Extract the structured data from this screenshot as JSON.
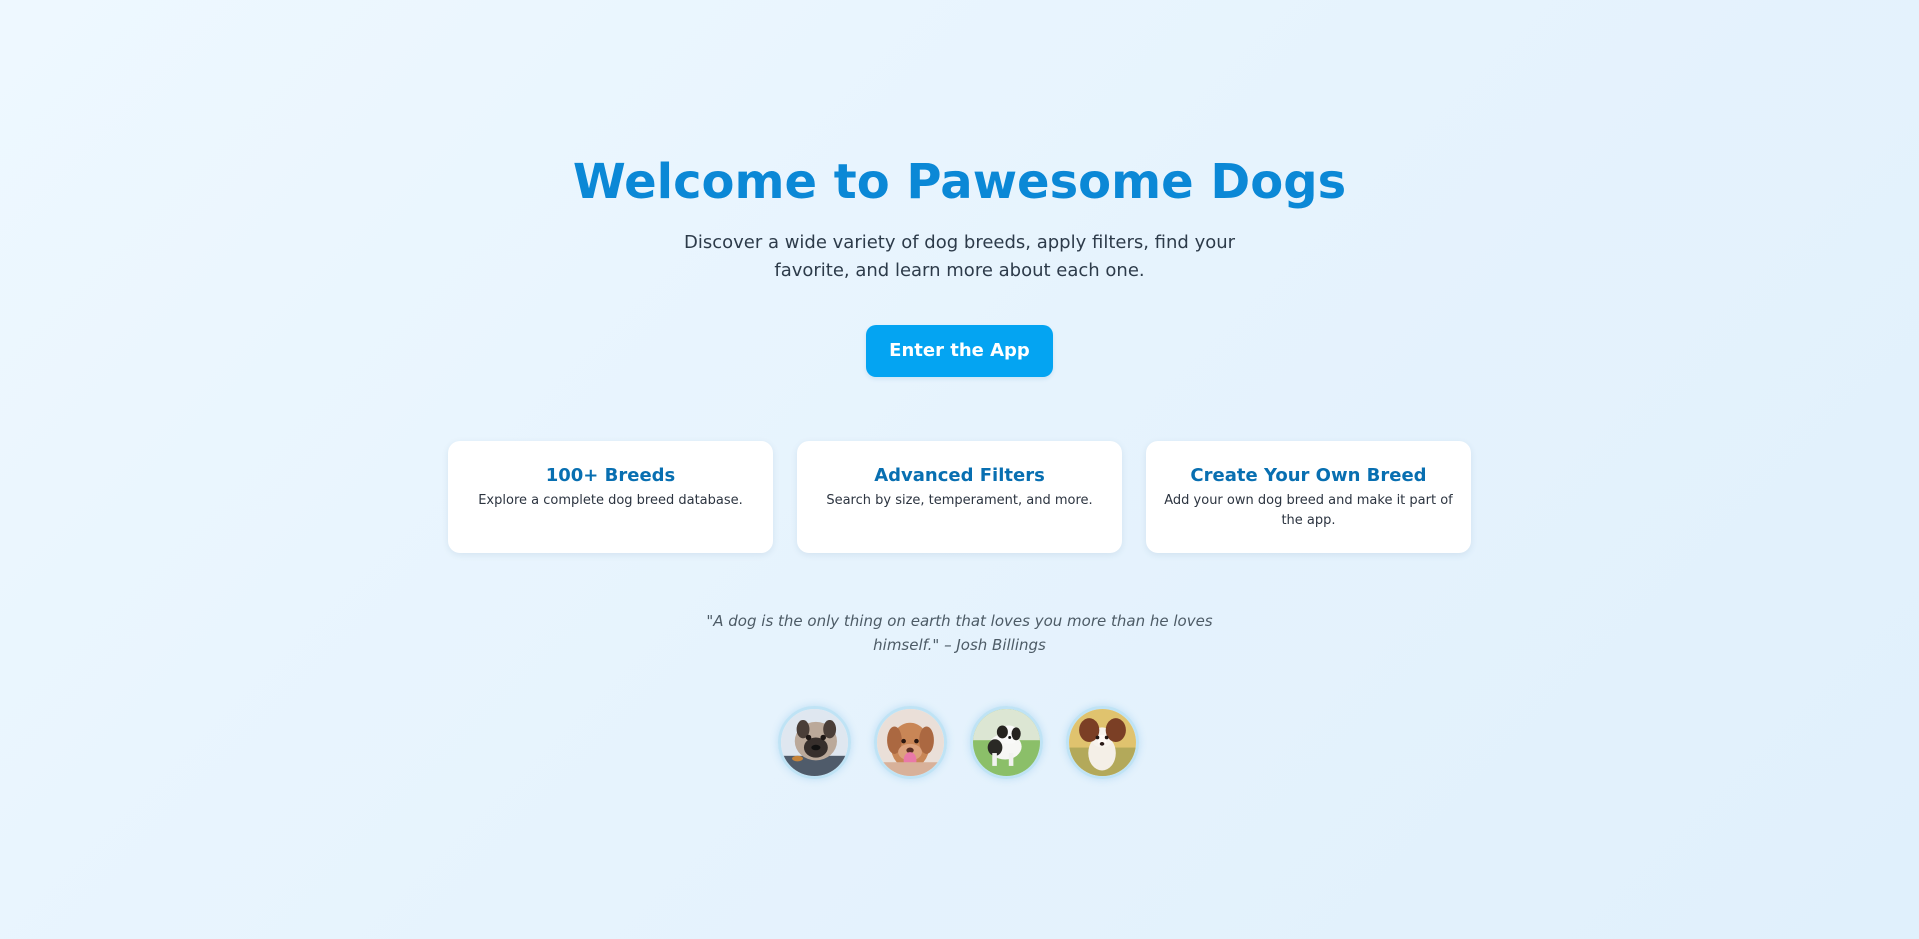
{
  "hero": {
    "title": "Welcome to Pawesome Dogs",
    "subtitle": "Discover a wide variety of dog breeds, apply filters, find your favorite, and learn more about each one."
  },
  "cta": {
    "label": "Enter the App"
  },
  "features": [
    {
      "title": "100+ Breeds",
      "description": "Explore a complete dog breed database."
    },
    {
      "title": "Advanced Filters",
      "description": "Search by size, temperament, and more."
    },
    {
      "title": "Create Your Own Breed",
      "description": "Add your own dog breed and make it part of the app."
    }
  ],
  "quote": {
    "text": "\"A dog is the only thing on earth that loves you more than he loves himself.\" – Josh Billings"
  },
  "gallery": {
    "items": [
      {
        "icon": "pug-photo"
      },
      {
        "icon": "retriever-photo"
      },
      {
        "icon": "border-collie-photo"
      },
      {
        "icon": "papillon-photo"
      }
    ]
  },
  "colors": {
    "accent": "#0b88d6",
    "button": "#04a4f2",
    "card": "#ffffff",
    "background": "#e6f3fd"
  }
}
